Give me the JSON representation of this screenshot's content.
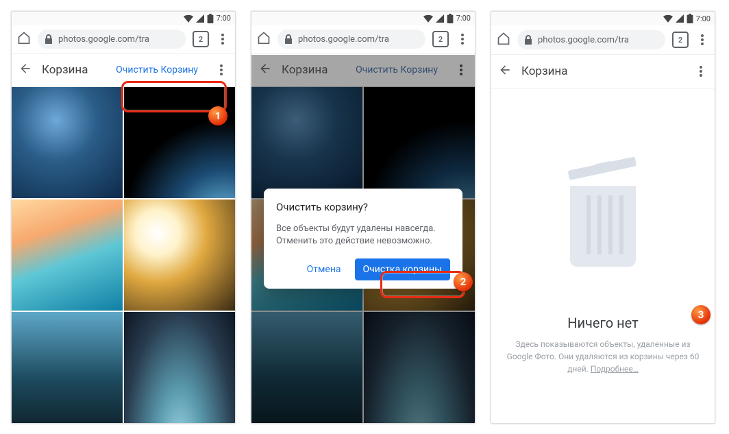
{
  "status": {
    "time": "7:00"
  },
  "browser": {
    "url": "photos.google.com/tra",
    "tab_count": "2"
  },
  "trash": {
    "back_label": "Назад",
    "title": "Корзина",
    "clear_label": "Очистить Корзину"
  },
  "dialog": {
    "title": "Очистить корзину?",
    "body": "Все объекты будут удалены навсегда. Отменить это действие невозможно.",
    "cancel": "Отмена",
    "confirm": "Очистка корзины"
  },
  "empty": {
    "title": "Ничего нет",
    "desc_prefix": "Здесь показываются объекты, удаленные из Google Фото. Они удаляются из корзины через 60 дней. ",
    "more": "Подробнее…"
  },
  "badges": {
    "one": "1",
    "two": "2",
    "three": "3"
  }
}
